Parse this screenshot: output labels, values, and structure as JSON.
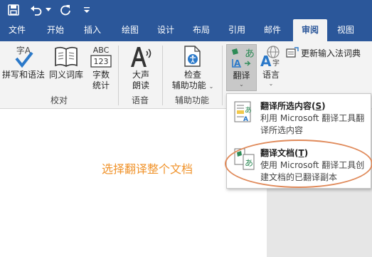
{
  "quick_access": {
    "save_icon": "save-icon",
    "undo_icon": "undo-icon",
    "redo_icon": "redo-icon",
    "customize_icon": "customize-qat-icon"
  },
  "tabs": [
    {
      "id": "file",
      "label": "文件"
    },
    {
      "id": "home",
      "label": "开始"
    },
    {
      "id": "insert",
      "label": "插入"
    },
    {
      "id": "draw",
      "label": "绘图"
    },
    {
      "id": "design",
      "label": "设计"
    },
    {
      "id": "layout",
      "label": "布局"
    },
    {
      "id": "references",
      "label": "引用"
    },
    {
      "id": "mailings",
      "label": "邮件"
    },
    {
      "id": "review",
      "label": "审阅"
    },
    {
      "id": "view",
      "label": "视图"
    }
  ],
  "active_tab": "审阅",
  "ribbon": {
    "proofing": {
      "label": "校对",
      "spelling": "拼写和语法",
      "thesaurus": "同义词库",
      "word_count_line1": "字数",
      "word_count_line2": "统计",
      "abc_text": "ABC",
      "num_text": "123",
      "zi_text": "字A"
    },
    "speech": {
      "label": "语音",
      "read_aloud_line1": "大声",
      "read_aloud_line2": "朗读"
    },
    "accessibility": {
      "label": "辅助功能",
      "check_line1": "检查",
      "check_line2": "辅助功能"
    },
    "language": {
      "translate": "翻译",
      "language": "语言",
      "update_ime": "更新输入法词典"
    }
  },
  "translate_menu": {
    "items": [
      {
        "title": "翻译所选内容(",
        "key": "S",
        "title_end": ")",
        "desc": "利用 Microsoft 翻译工具翻译所选内容"
      },
      {
        "title": "翻译文档(",
        "key": "T",
        "title_end": ")",
        "desc": "使用 Microsoft 翻译工具创建文档的已翻译副本"
      }
    ]
  },
  "annotation": "选择翻译整个文档",
  "colors": {
    "ribbon_blue": "#2b579a",
    "annotation_orange": "#f0932b",
    "highlight_ellipse": "#e08a5a"
  }
}
